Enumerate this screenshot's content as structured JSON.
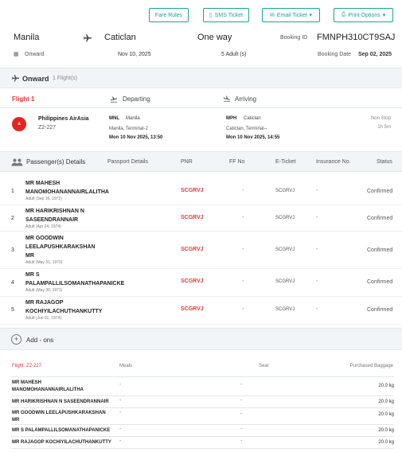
{
  "toolbar": {
    "fare_rules": "Fare Rules",
    "sms_ticket": "SMS Ticket",
    "email_ticket": "Email Ticket",
    "print_options": "Print Options"
  },
  "header": {
    "origin": "Manila",
    "destination": "Caticlan",
    "trip_type": "One way",
    "booking_id_label": "Booking ID",
    "booking_id": "FMNPH310CT9SAJ",
    "direction": "Onward",
    "travel_date": "Nov 10, 2025",
    "travellers": "5 Adult (s)",
    "booking_date_label": "Booking Date",
    "booking_date": "Sep 02, 2025"
  },
  "onward": {
    "title": "Onward",
    "count": "1 Flight(s)"
  },
  "flight": {
    "label": "Flight 1",
    "departing_label": "Departing",
    "arriving_label": "Arriving",
    "airline": "Philippines AirAsia",
    "flight_no": "Z2-227",
    "dep_code": "MNL",
    "dep_city": "Manila",
    "dep_terminal": "Manila, Terminal-2",
    "dep_time": "Mon 10 Nov 2025, 13:50",
    "arr_code": "MPH",
    "arr_city": "Caticlan",
    "arr_terminal": "Caticlan, Terminal--",
    "arr_time": "Mon 10 Nov 2025, 14:55",
    "stops": "Non Stop",
    "duration": "1h 5m"
  },
  "passengers": {
    "title": "Passenger(s) Details",
    "columns": {
      "passport": "Passport Details",
      "pnr": "PNR",
      "ff": "FF No",
      "eticket": "E-Ticket",
      "insurance": "Insurance No.",
      "status": "Status"
    },
    "rows": [
      {
        "num": "1",
        "line1": "MR MAHESH",
        "line2": "MANOMOHANANNAIRLALITHA",
        "line3": "",
        "dob": "Adult (Sep 16, 1972)",
        "pnr": "SCGRVJ",
        "ff": "-",
        "eticket": "SCGRVJ",
        "insurance": "-",
        "status": "Confirmed"
      },
      {
        "num": "2",
        "line1": "MR HARIKRISHNAN N",
        "line2": "SASEENDRANNAIR",
        "line3": "",
        "dob": "Adult (Apr 24, 1974)",
        "pnr": "SCGRVJ",
        "ff": "-",
        "eticket": "SCGRVJ",
        "insurance": "-",
        "status": "Confirmed"
      },
      {
        "num": "3",
        "line1": "MR GOODWIN",
        "line2": "LEELAPUSHKARAKSHAN",
        "line3": "MR",
        "dob": "Adult (May 31, 1970)",
        "pnr": "SCGRVJ",
        "ff": "-",
        "eticket": "SCGRVJ",
        "insurance": "-",
        "status": "Confirmed"
      },
      {
        "num": "4",
        "line1": "MR S",
        "line2": "PALAMPALLILSOMANATHAPANICKE",
        "line3": "",
        "dob": "Adult (May 30, 1971)",
        "pnr": "SCGRVJ",
        "ff": "-",
        "eticket": "SCGRVJ",
        "insurance": "-",
        "status": "Confirmed"
      },
      {
        "num": "5",
        "line1": "MR RAJAGOP",
        "line2": "KOCHIYILACHUTHANKUTTY",
        "line3": "",
        "dob": "Adult (Jun 01, 1974)",
        "pnr": "SCGRVJ",
        "ff": "-",
        "eticket": "SCGRVJ",
        "insurance": "-",
        "status": "Confirmed"
      }
    ]
  },
  "addons": {
    "title": "Add - ons",
    "flight_label": "Flight: Z2-227",
    "meals_label": "Meals",
    "seat_label": "Seat",
    "baggage_label": "Purchased Baggage",
    "rows": [
      {
        "line1": "MR MAHESH",
        "line2": "MANOMOHANANNAIRLALITHA",
        "meals": "-",
        "seat": "-",
        "baggage": "20.0 kg"
      },
      {
        "line1": "MR HARIKRISHNAN N SASEENDRANNAIR",
        "line2": "",
        "meals": "-",
        "seat": "-",
        "baggage": "20.0 kg"
      },
      {
        "line1": "MR GOODWIN LEELAPUSHKARAKSHAN",
        "line2": "MR",
        "meals": "-",
        "seat": "-",
        "baggage": "20.0 kg"
      },
      {
        "line1": "MR S PALAMPALLILSOMANATHAPANICKE",
        "line2": "",
        "meals": "-",
        "seat": "-",
        "baggage": "20.0 kg"
      },
      {
        "line1": "MR RAJAGOP KOCHIYILACHUTHANKUTTY",
        "line2": "",
        "meals": "-",
        "seat": "-",
        "baggage": "20.0 kg"
      }
    ]
  },
  "colors": {
    "accent": "#1ba39c",
    "pnr": "#e53935",
    "airline_logo": "#e52421"
  }
}
